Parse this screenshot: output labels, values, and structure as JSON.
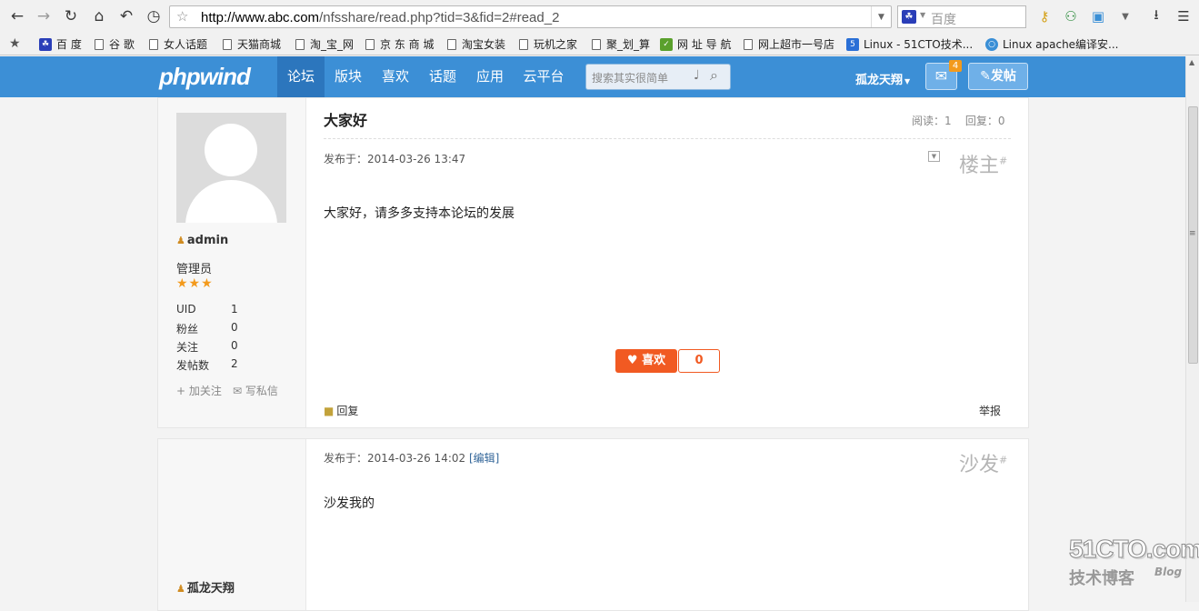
{
  "browser": {
    "url_host": "http://www.abc.com",
    "url_path": "/nfsshare/read.php?tid=3&fid=2#read_2",
    "search_engine": "百度"
  },
  "bookmarks": [
    {
      "label": "百 度",
      "icon": "baidu-icon"
    },
    {
      "label": "谷 歌",
      "icon": "page-icon"
    },
    {
      "label": "女人话题",
      "icon": "page-icon"
    },
    {
      "label": "天猫商城",
      "icon": "page-icon"
    },
    {
      "label": "淘_宝_网",
      "icon": "page-icon"
    },
    {
      "label": "京 东 商 城",
      "icon": "page-icon"
    },
    {
      "label": "淘宝女装",
      "icon": "page-icon"
    },
    {
      "label": "玩机之家",
      "icon": "page-icon"
    },
    {
      "label": "聚_划_算",
      "icon": "page-icon"
    },
    {
      "label": "网 址 导 航",
      "icon": "hao-icon"
    },
    {
      "label": "网上超市一号店",
      "icon": "page-icon"
    },
    {
      "label": "Linux - 51CTO技术...",
      "icon": "51cto-icon"
    },
    {
      "label": "Linux apache编译安...",
      "icon": "chrome-icon"
    }
  ],
  "site": {
    "logo": "phpwind",
    "nav": [
      "论坛",
      "版块",
      "喜欢",
      "话题",
      "应用",
      "云平台"
    ],
    "search_placeholder": "搜索其实很简单",
    "user": "孤龙天翔",
    "mail_count": "4",
    "post_button": "发帖"
  },
  "posts": [
    {
      "title": "大家好",
      "views_label": "阅读：1",
      "replies_label": "回复：0",
      "date": "发布于：2014-03-26 13:47",
      "floor": "楼主",
      "body": "大家好，请多多支持本论坛的发展",
      "like_label": "喜欢",
      "like_count": "0",
      "reply_label": "回复",
      "report_label": "举报",
      "author": {
        "name": "admin",
        "role": "管理员",
        "stars": "★★★",
        "stats": [
          {
            "label": "UID",
            "value": "1"
          },
          {
            "label": "粉丝",
            "value": "0"
          },
          {
            "label": "关注",
            "value": "0"
          },
          {
            "label": "发帖数",
            "value": "2"
          }
        ],
        "follow_label": "加关注",
        "message_label": "写私信"
      }
    },
    {
      "date": "发布于：2014-03-26 14:02",
      "edit_label": "[编辑]",
      "floor": "沙发",
      "body": "沙发我的",
      "author": {
        "name": "孤龙天翔"
      }
    }
  ],
  "watermark": {
    "brand": "51CTO.com",
    "cn": "技术博客",
    "blog": "Blog"
  },
  "colors": {
    "nav_bg": "#3c8fd6",
    "nav_active": "#2c76bd",
    "like": "#f15a22",
    "star": "#f39a1c"
  }
}
